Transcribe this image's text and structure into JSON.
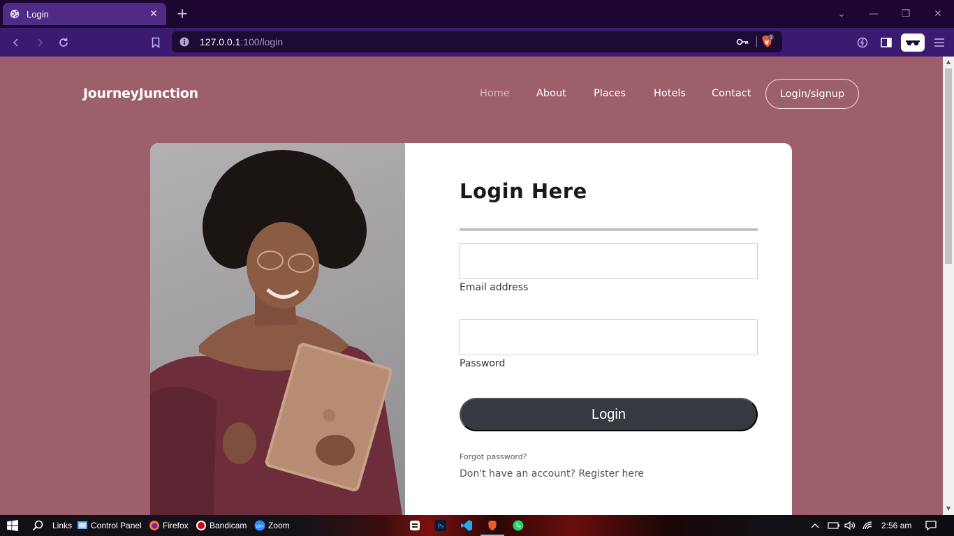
{
  "browser": {
    "tab_title": "Login",
    "tab_close": "✕",
    "new_tab": "+",
    "url_host": "127.0.0.1",
    "url_path": ":100/login",
    "shield_badge": "1",
    "window_controls": [
      "⌄",
      "—",
      "❐",
      "✕"
    ]
  },
  "site": {
    "brand": "JourneyJunction",
    "nav": [
      "Home",
      "About",
      "Places",
      "Hotels",
      "Contact"
    ],
    "nav_active": "Home",
    "login_signup": "Login/signup"
  },
  "form": {
    "title": "Login Here",
    "email_label": "Email address",
    "email_value": "",
    "password_label": "Password",
    "password_value": "",
    "submit": "Login",
    "forgot": "Forgot password?",
    "register": "Don't have an account? Register here"
  },
  "taskbar": {
    "items": [
      "Links",
      "Control Panel",
      "Firefox",
      "Bandicam",
      "Zoom"
    ],
    "time": "2:56 am"
  },
  "colors": {
    "page_bg": "#9e5f6c",
    "tab_active": "#4f2a87",
    "toolbar": "#3d1a72",
    "button_dark": "#343a40"
  }
}
